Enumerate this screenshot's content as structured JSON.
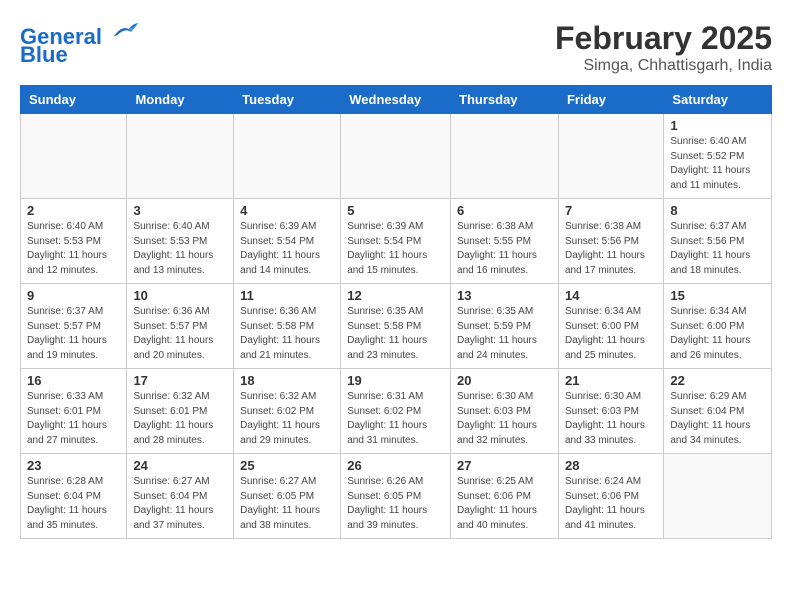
{
  "header": {
    "logo_general": "General",
    "logo_blue": "Blue",
    "month_title": "February 2025",
    "location": "Simga, Chhattisgarh, India"
  },
  "weekdays": [
    "Sunday",
    "Monday",
    "Tuesday",
    "Wednesday",
    "Thursday",
    "Friday",
    "Saturday"
  ],
  "weeks": [
    [
      {
        "day": "",
        "info": ""
      },
      {
        "day": "",
        "info": ""
      },
      {
        "day": "",
        "info": ""
      },
      {
        "day": "",
        "info": ""
      },
      {
        "day": "",
        "info": ""
      },
      {
        "day": "",
        "info": ""
      },
      {
        "day": "1",
        "info": "Sunrise: 6:40 AM\nSunset: 5:52 PM\nDaylight: 11 hours\nand 11 minutes."
      }
    ],
    [
      {
        "day": "2",
        "info": "Sunrise: 6:40 AM\nSunset: 5:53 PM\nDaylight: 11 hours\nand 12 minutes."
      },
      {
        "day": "3",
        "info": "Sunrise: 6:40 AM\nSunset: 5:53 PM\nDaylight: 11 hours\nand 13 minutes."
      },
      {
        "day": "4",
        "info": "Sunrise: 6:39 AM\nSunset: 5:54 PM\nDaylight: 11 hours\nand 14 minutes."
      },
      {
        "day": "5",
        "info": "Sunrise: 6:39 AM\nSunset: 5:54 PM\nDaylight: 11 hours\nand 15 minutes."
      },
      {
        "day": "6",
        "info": "Sunrise: 6:38 AM\nSunset: 5:55 PM\nDaylight: 11 hours\nand 16 minutes."
      },
      {
        "day": "7",
        "info": "Sunrise: 6:38 AM\nSunset: 5:56 PM\nDaylight: 11 hours\nand 17 minutes."
      },
      {
        "day": "8",
        "info": "Sunrise: 6:37 AM\nSunset: 5:56 PM\nDaylight: 11 hours\nand 18 minutes."
      }
    ],
    [
      {
        "day": "9",
        "info": "Sunrise: 6:37 AM\nSunset: 5:57 PM\nDaylight: 11 hours\nand 19 minutes."
      },
      {
        "day": "10",
        "info": "Sunrise: 6:36 AM\nSunset: 5:57 PM\nDaylight: 11 hours\nand 20 minutes."
      },
      {
        "day": "11",
        "info": "Sunrise: 6:36 AM\nSunset: 5:58 PM\nDaylight: 11 hours\nand 21 minutes."
      },
      {
        "day": "12",
        "info": "Sunrise: 6:35 AM\nSunset: 5:58 PM\nDaylight: 11 hours\nand 23 minutes."
      },
      {
        "day": "13",
        "info": "Sunrise: 6:35 AM\nSunset: 5:59 PM\nDaylight: 11 hours\nand 24 minutes."
      },
      {
        "day": "14",
        "info": "Sunrise: 6:34 AM\nSunset: 6:00 PM\nDaylight: 11 hours\nand 25 minutes."
      },
      {
        "day": "15",
        "info": "Sunrise: 6:34 AM\nSunset: 6:00 PM\nDaylight: 11 hours\nand 26 minutes."
      }
    ],
    [
      {
        "day": "16",
        "info": "Sunrise: 6:33 AM\nSunset: 6:01 PM\nDaylight: 11 hours\nand 27 minutes."
      },
      {
        "day": "17",
        "info": "Sunrise: 6:32 AM\nSunset: 6:01 PM\nDaylight: 11 hours\nand 28 minutes."
      },
      {
        "day": "18",
        "info": "Sunrise: 6:32 AM\nSunset: 6:02 PM\nDaylight: 11 hours\nand 29 minutes."
      },
      {
        "day": "19",
        "info": "Sunrise: 6:31 AM\nSunset: 6:02 PM\nDaylight: 11 hours\nand 31 minutes."
      },
      {
        "day": "20",
        "info": "Sunrise: 6:30 AM\nSunset: 6:03 PM\nDaylight: 11 hours\nand 32 minutes."
      },
      {
        "day": "21",
        "info": "Sunrise: 6:30 AM\nSunset: 6:03 PM\nDaylight: 11 hours\nand 33 minutes."
      },
      {
        "day": "22",
        "info": "Sunrise: 6:29 AM\nSunset: 6:04 PM\nDaylight: 11 hours\nand 34 minutes."
      }
    ],
    [
      {
        "day": "23",
        "info": "Sunrise: 6:28 AM\nSunset: 6:04 PM\nDaylight: 11 hours\nand 35 minutes."
      },
      {
        "day": "24",
        "info": "Sunrise: 6:27 AM\nSunset: 6:04 PM\nDaylight: 11 hours\nand 37 minutes."
      },
      {
        "day": "25",
        "info": "Sunrise: 6:27 AM\nSunset: 6:05 PM\nDaylight: 11 hours\nand 38 minutes."
      },
      {
        "day": "26",
        "info": "Sunrise: 6:26 AM\nSunset: 6:05 PM\nDaylight: 11 hours\nand 39 minutes."
      },
      {
        "day": "27",
        "info": "Sunrise: 6:25 AM\nSunset: 6:06 PM\nDaylight: 11 hours\nand 40 minutes."
      },
      {
        "day": "28",
        "info": "Sunrise: 6:24 AM\nSunset: 6:06 PM\nDaylight: 11 hours\nand 41 minutes."
      },
      {
        "day": "",
        "info": ""
      }
    ]
  ]
}
